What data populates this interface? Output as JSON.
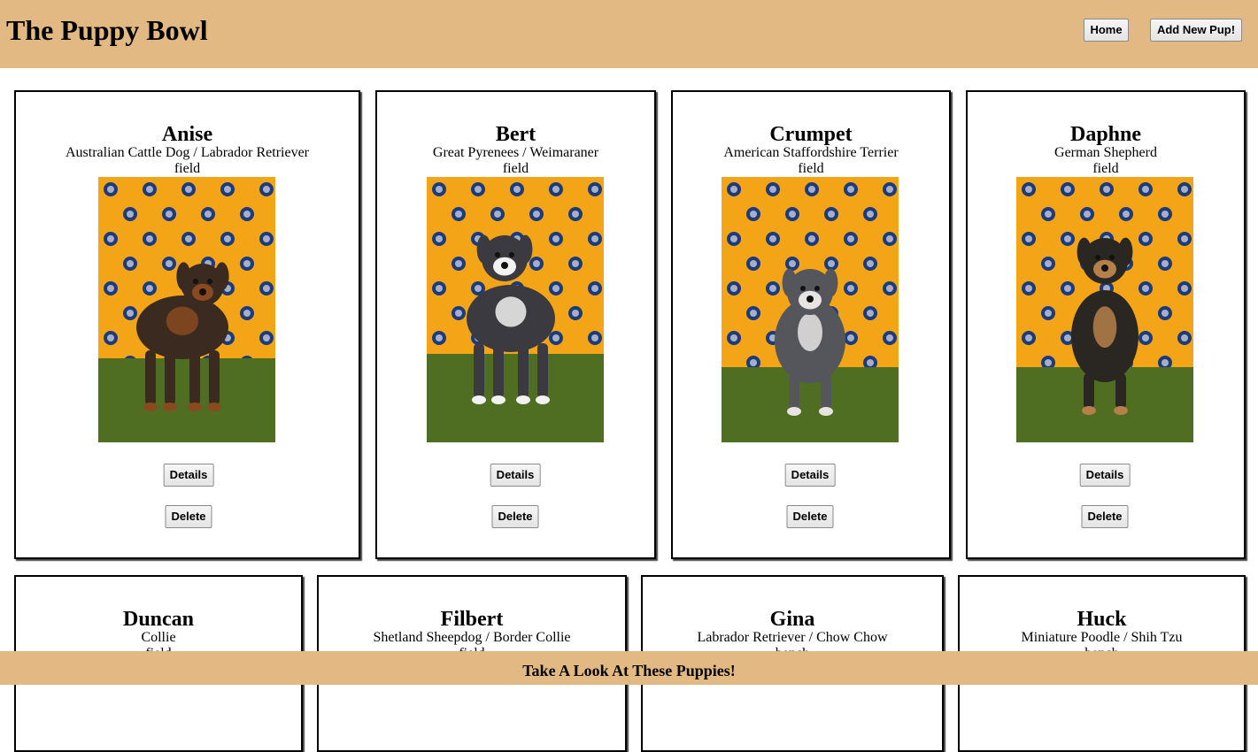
{
  "header": {
    "title": "The Puppy Bowl",
    "nav": {
      "home_label": "Home",
      "add_label": "Add New Pup!"
    }
  },
  "puppies": [
    {
      "name": "Anise",
      "breed": "Australian Cattle Dog / Labrador Retriever",
      "status": "field",
      "details_label": "Details",
      "delete_label": "Delete",
      "coat": "#3a2a1f",
      "accent": "#8a4a20"
    },
    {
      "name": "Bert",
      "breed": "Great Pyrenees / Weimaraner",
      "status": "field",
      "details_label": "Details",
      "delete_label": "Delete",
      "coat": "#3a3a40",
      "accent": "#f2f2f2"
    },
    {
      "name": "Crumpet",
      "breed": "American Staffordshire Terrier",
      "status": "field",
      "details_label": "Details",
      "delete_label": "Delete",
      "coat": "#55565c",
      "accent": "#e8e4e4"
    },
    {
      "name": "Daphne",
      "breed": "German Shepherd",
      "status": "field",
      "details_label": "Details",
      "delete_label": "Delete",
      "coat": "#2a2622",
      "accent": "#b5804a"
    },
    {
      "name": "Duncan",
      "breed": "Collie",
      "status": "field"
    },
    {
      "name": "Filbert",
      "breed": "Shetland Sheepdog / Border Collie",
      "status": "field"
    },
    {
      "name": "Gina",
      "breed": "Labrador Retriever / Chow Chow",
      "status": "bench"
    },
    {
      "name": "Huck",
      "breed": "Miniature Poodle / Shih Tzu",
      "status": "bench"
    }
  ],
  "footer": {
    "text": "Take A Look At These Puppies!"
  },
  "colors": {
    "header_bg": "#e2b983",
    "photo_backdrop": "#f3a517",
    "turf": "#4f6e22"
  }
}
